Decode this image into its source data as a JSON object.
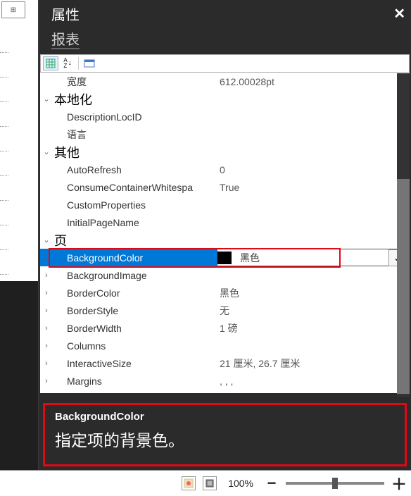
{
  "panel": {
    "title": "属性",
    "object": "报表"
  },
  "close_glyph": "✕",
  "toolbar": {
    "categorized": "▦",
    "az": "A Z",
    "pages": "▭"
  },
  "rows": [
    {
      "kind": "prop",
      "indent": 1,
      "exp": "",
      "label": "宽度",
      "value": "612.00028pt"
    },
    {
      "kind": "cat",
      "indent": 0,
      "exp": "⌄",
      "label": "本地化"
    },
    {
      "kind": "prop",
      "indent": 1,
      "exp": "",
      "label": "DescriptionLocID",
      "value": ""
    },
    {
      "kind": "prop",
      "indent": 1,
      "exp": "",
      "label": "语言",
      "value": ""
    },
    {
      "kind": "cat",
      "indent": 0,
      "exp": "⌄",
      "label": "其他"
    },
    {
      "kind": "prop",
      "indent": 1,
      "exp": "",
      "label": "AutoRefresh",
      "value": "0"
    },
    {
      "kind": "prop",
      "indent": 1,
      "exp": "",
      "label": "ConsumeContainerWhitespa",
      "value": "True"
    },
    {
      "kind": "prop",
      "indent": 1,
      "exp": "",
      "label": "CustomProperties",
      "value": ""
    },
    {
      "kind": "prop",
      "indent": 1,
      "exp": "",
      "label": "InitialPageName",
      "value": ""
    },
    {
      "kind": "cat",
      "indent": 0,
      "exp": "⌄",
      "label": "页"
    },
    {
      "kind": "sel",
      "indent": 1,
      "exp": "",
      "label": "BackgroundColor",
      "value": "黑色",
      "swatch": "#000000"
    },
    {
      "kind": "prop",
      "indent": 1,
      "exp": "›",
      "label": "BackgroundImage",
      "value": ""
    },
    {
      "kind": "prop",
      "indent": 1,
      "exp": "›",
      "label": "BorderColor",
      "value": "黑色"
    },
    {
      "kind": "prop",
      "indent": 1,
      "exp": "›",
      "label": "BorderStyle",
      "value": "无"
    },
    {
      "kind": "prop",
      "indent": 1,
      "exp": "›",
      "label": "BorderWidth",
      "value": "1 磅"
    },
    {
      "kind": "prop",
      "indent": 1,
      "exp": "›",
      "label": "Columns",
      "value": ""
    },
    {
      "kind": "prop",
      "indent": 1,
      "exp": "›",
      "label": "InteractiveSize",
      "value": "21 厘米, 26.7 厘米"
    },
    {
      "kind": "prop",
      "indent": 1,
      "exp": "›",
      "label": "Margins",
      "value": ", , ,"
    }
  ],
  "dropdown_glyph": "⌄",
  "help": {
    "name": "BackgroundColor",
    "desc": "指定项的背景色。"
  },
  "status": {
    "zoom": "100%",
    "minus": "−",
    "plus": "＋"
  }
}
